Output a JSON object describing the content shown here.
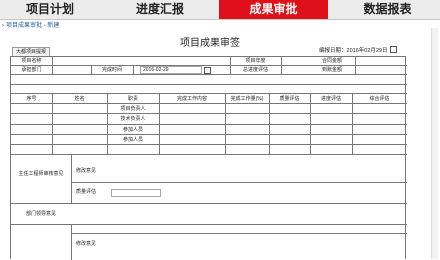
{
  "nav": {
    "tabs": [
      {
        "label": "项目计划"
      },
      {
        "label": "进度汇报"
      },
      {
        "label": "成果审批"
      },
      {
        "label": "数据报表"
      }
    ]
  },
  "breadcrumb": {
    "text": "项目成果审批 - 新建"
  },
  "toolbar": {
    "button_label": "大都项目提报"
  },
  "form": {
    "title": "项目成果审签",
    "date_label": "编报日期：",
    "date_value": "2016年02月29日",
    "labels": {
      "project_name": "项目名称",
      "project_year": "项目年度",
      "contract_amount": "合同金额",
      "bearing_dept": "承担部门",
      "finish_time": "完成时间",
      "finish_time_value": "2016-02-29",
      "total_score": "总进度评估",
      "arrival_amount": "到账金额"
    },
    "table_headers": [
      "序号",
      "姓名",
      "职责",
      "完成工作内容",
      "完成工作量(%)",
      "质量评估",
      "进度评估",
      "综合评估"
    ],
    "roles": [
      "项目负责人",
      "技术负责人",
      "参加人员",
      "参加人员"
    ],
    "review": {
      "chief_engineer": "主任工程师审核意见",
      "opinion_label": "修改意见",
      "quality_label": "质量评估",
      "dept_leader": "部门领导意见",
      "opinion_label2": "修改意见"
    }
  }
}
